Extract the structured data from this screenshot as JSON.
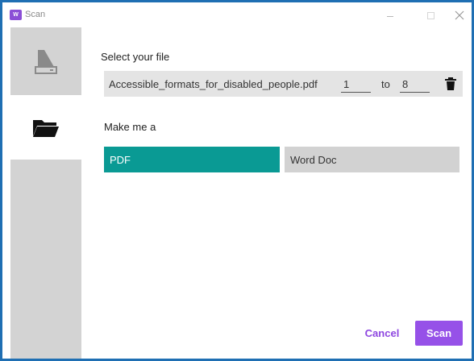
{
  "window": {
    "title": "Scan",
    "app_icon_text": "W",
    "accent_color": "#8b4fd6"
  },
  "sidebar": {
    "items": [
      {
        "name": "scanner",
        "icon": "scanner-icon",
        "selected": false
      },
      {
        "name": "files",
        "icon": "folder-icon",
        "selected": true
      }
    ]
  },
  "main": {
    "select_label": "Select your file",
    "file_name": "Accessible_formats_for_disabled_people.pdf",
    "page_from": "1",
    "to_label": "to",
    "page_to": "8",
    "make_label": "Make me a",
    "options": [
      {
        "label": "PDF",
        "selected": true,
        "color": "#0a9a94"
      },
      {
        "label": "Word Doc",
        "selected": false,
        "color": "#d2d2d2"
      }
    ]
  },
  "footer": {
    "cancel_label": "Cancel",
    "scan_label": "Scan",
    "scan_color": "#9651e8"
  }
}
